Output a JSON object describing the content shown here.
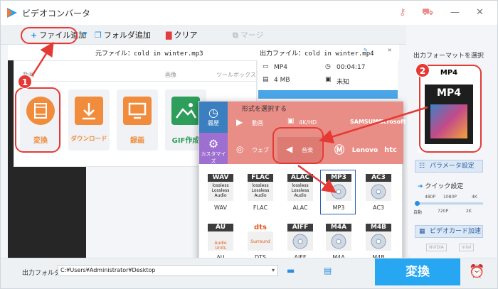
{
  "app": {
    "title": "ビデオコンバータ"
  },
  "toolbar": {
    "add_file": "ファイル追加",
    "add_folder": "フォルダ追加",
    "clear": "クリア",
    "merge": "マージ"
  },
  "files": {
    "source_label": "元ファイル：cold in winter.mp3",
    "output_label": "出力ファイル：cold in winter.mp4"
  },
  "launcher": {
    "tabs": [
      "動画",
      "画像",
      "ツールボックス"
    ],
    "tiles": [
      {
        "label": "変換",
        "color": "#f08c3c"
      },
      {
        "label": "ダウンロード",
        "color": "#f08c3c"
      },
      {
        "label": "録画",
        "color": "#f08c3c"
      },
      {
        "label": "GIF作成",
        "color": "#2e9e5b"
      }
    ]
  },
  "info": {
    "format": "MP4",
    "duration": "00:04:17",
    "size": "4 MB",
    "unknown": "未知"
  },
  "dialog": {
    "title": "形式を選択する",
    "side": [
      {
        "label": "履歴"
      },
      {
        "label": "カスタマイズ"
      }
    ],
    "categories": [
      "動画",
      "4K/HD",
      "ウェブ",
      "音楽"
    ],
    "brands": [
      "SAMSUNG",
      "Microsoft",
      "Lenovo",
      "htc"
    ],
    "formats": [
      {
        "name": "WAV",
        "tag": "WAV",
        "sub": "lossless Lossless Audio"
      },
      {
        "name": "FLAC",
        "tag": "FLAC",
        "sub": "lossless Lossless Audio"
      },
      {
        "name": "ALAC",
        "tag": "ALAC",
        "sub": "lossless Lossless Audio"
      },
      {
        "name": "MP3",
        "tag": "MP3",
        "sub": ""
      },
      {
        "name": "AC3",
        "tag": "AC3",
        "sub": ""
      },
      {
        "name": "AU",
        "tag": "AU",
        "sub": "Audio Units"
      },
      {
        "name": "DTS",
        "tag": "dts",
        "sub": "Surround"
      },
      {
        "name": "AIFF",
        "tag": "AIFF",
        "sub": ""
      },
      {
        "name": "M4A",
        "tag": "M4A",
        "sub": ""
      },
      {
        "name": "M4B",
        "tag": "M4B",
        "sub": ""
      }
    ]
  },
  "right": {
    "title": "出力フォーマットを選択",
    "selected_format": "MP4",
    "format_tile": "MP4",
    "params_button": "パラメータ設定",
    "quick_label": "クイック設定",
    "quality_top": [
      "480P",
      "1080P",
      "4K"
    ],
    "quality_bottom": [
      "自動",
      "720P",
      "2K"
    ],
    "gpu_button": "ビデオカード加速",
    "gpu_vendors": [
      "NVIDIA",
      "intel"
    ]
  },
  "bottom": {
    "output_folder_label": "出力フォルダ：",
    "output_path": "C:¥Users¥Administrator¥Desktop",
    "convert_button": "変換"
  },
  "annotations": {
    "step1": "1",
    "step2": "2"
  },
  "colors": {
    "accent": "#27a6f2",
    "annotation": "#e53935",
    "header": "#e98e86",
    "orange": "#f08c3c"
  }
}
